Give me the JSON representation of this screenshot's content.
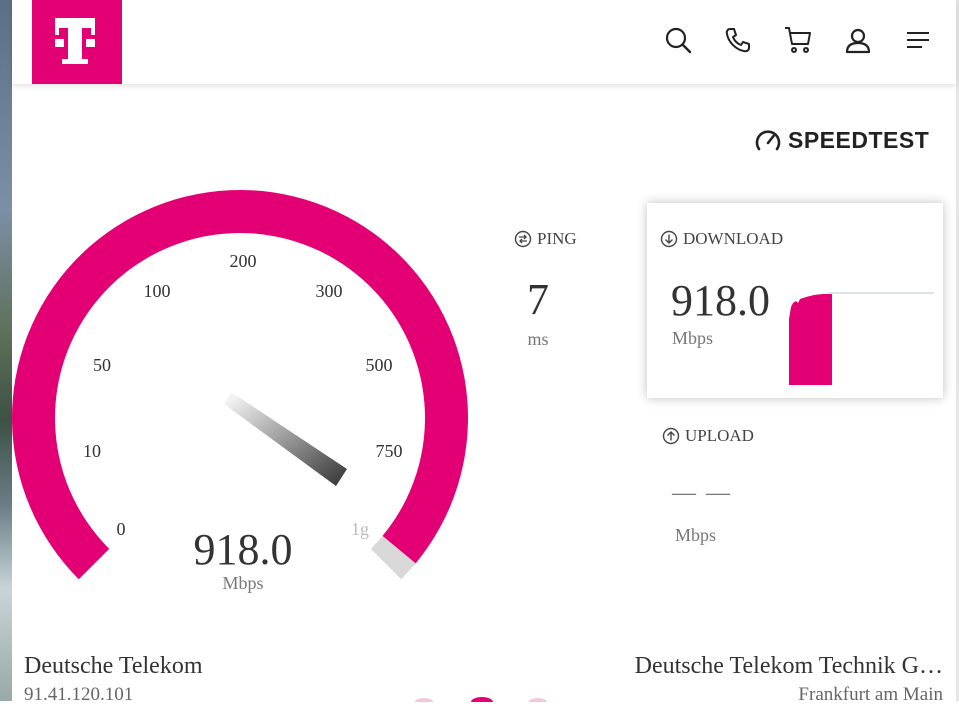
{
  "header": {
    "logo_letter": "T",
    "brand_color": "#e20074",
    "nav_icons": [
      "search-icon",
      "phone-icon",
      "cart-icon",
      "user-icon",
      "menu-icon"
    ]
  },
  "speedtest_brand": {
    "label": "SPEEDTEST",
    "icon": "gauge-icon"
  },
  "gauge": {
    "scale_labels": [
      "0",
      "10",
      "50",
      "100",
      "200",
      "300",
      "500",
      "750",
      "1g"
    ],
    "value": "918.0",
    "unit": "Mbps",
    "arc_color": "#e20074",
    "remaining_color": "#d9d9d9",
    "fill_fraction": 0.98
  },
  "ping": {
    "label": "PING",
    "value": "7",
    "unit": "ms"
  },
  "download": {
    "label": "DOWNLOAD",
    "value": "918.0",
    "unit": "Mbps"
  },
  "upload": {
    "label": "UPLOAD",
    "value": "— —",
    "unit": "Mbps"
  },
  "isp": {
    "name": "Deutsche Telekom",
    "ip": "91.41.120.101"
  },
  "server": {
    "name": "Deutsche Telekom Technik G…",
    "location": "Frankfurt am Main"
  }
}
